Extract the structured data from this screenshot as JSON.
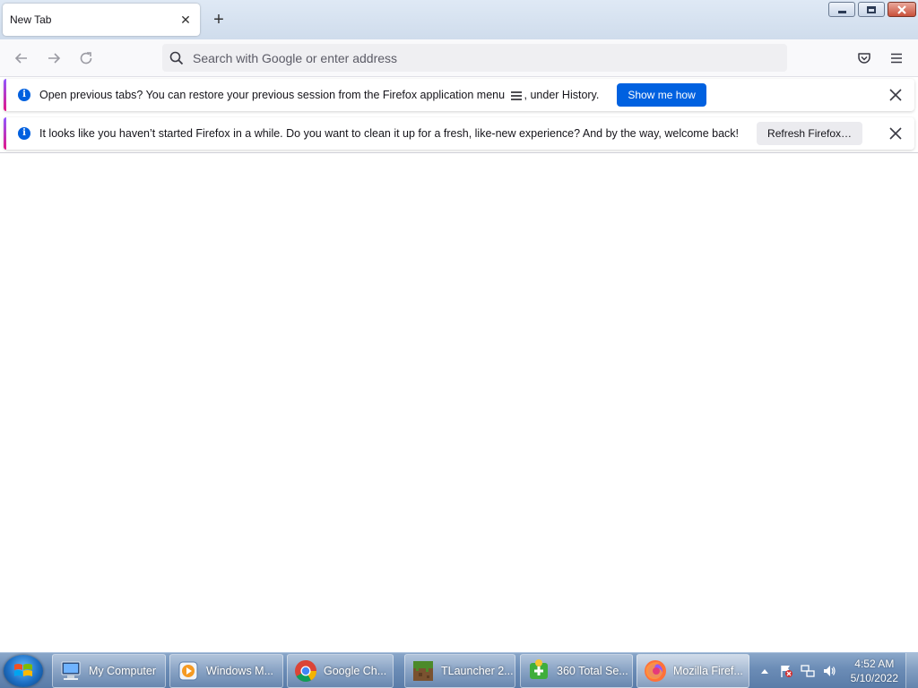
{
  "tab": {
    "title": "New Tab",
    "close_glyph": "✕",
    "new_tab_glyph": "+"
  },
  "window_controls": {
    "minimize": "minimize-icon",
    "restore": "restore-icon",
    "close": "close-icon"
  },
  "navbar": {
    "back": "back-arrow-icon",
    "forward": "forward-arrow-icon",
    "reload": "reload-icon",
    "search_placeholder": "Search with Google or enter address",
    "pocket": "pocket-icon",
    "menu": "hamburger-menu-icon"
  },
  "notifications": [
    {
      "text_before": "Open previous tabs?",
      "text_main": " You can restore your previous session from the Firefox application menu ",
      "text_after": ", under History.",
      "button": "Show me how",
      "button_style": "primary"
    },
    {
      "text_main": "It looks like you haven’t started Firefox in a while. Do you want to clean it up for a fresh, like-new experience? And by the way, welcome back!",
      "button": "Refresh Firefox…",
      "button_style": "secondary"
    }
  ],
  "colors": {
    "accent": "#0061e0",
    "info": "#0060df",
    "gradient_top": "#9059ff",
    "gradient_bottom": "#e31587"
  },
  "taskbar": {
    "items": [
      {
        "label": "My Computer",
        "icon": "computer-icon"
      },
      {
        "label": "Windows M...",
        "icon": "media-player-icon"
      },
      {
        "label": "Google Ch...",
        "icon": "chrome-icon"
      },
      {
        "label": "TLauncher 2...",
        "icon": "minecraft-block-icon"
      },
      {
        "label": "360 Total Se...",
        "icon": "360-security-icon"
      },
      {
        "label": "Mozilla Firef...",
        "icon": "firefox-icon",
        "active": true
      }
    ],
    "clock": {
      "time": "4:52 AM",
      "date": "5/10/2022"
    }
  }
}
